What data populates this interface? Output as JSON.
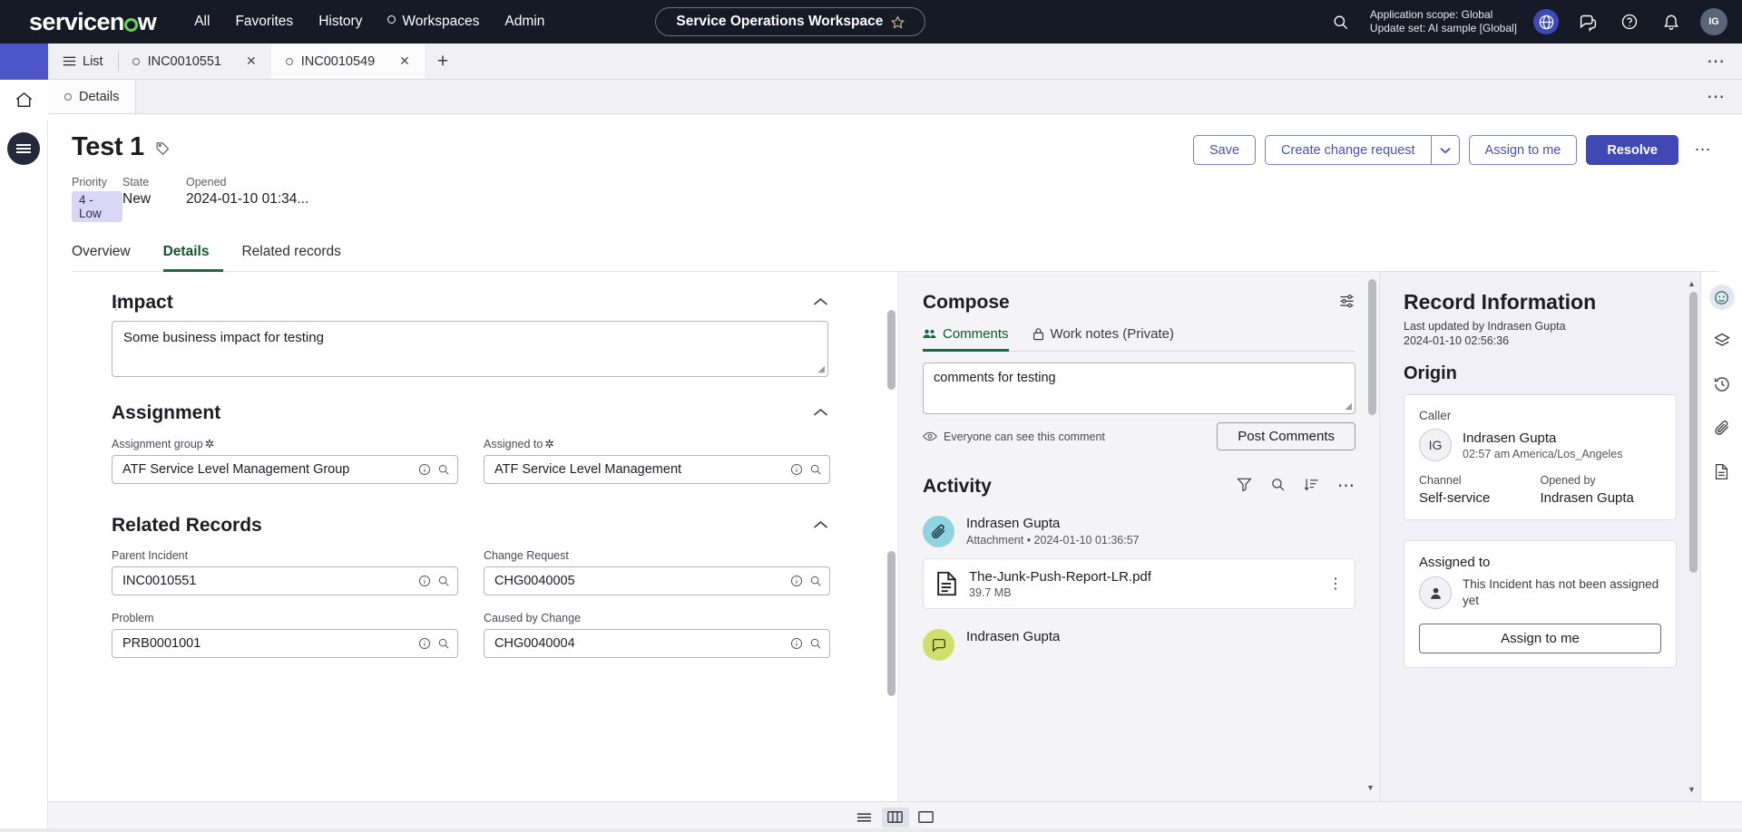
{
  "topnav": {
    "brand": "servicenow",
    "links": [
      {
        "label": "All",
        "icon": ""
      },
      {
        "label": "Favorites",
        "icon": ""
      },
      {
        "label": "History",
        "icon": ""
      },
      {
        "label": "Workspaces",
        "icon": "circle-icon"
      },
      {
        "label": "Admin",
        "icon": ""
      }
    ],
    "workspace_pill": "Service Operations Workspace",
    "star_icon": "star-icon",
    "search_icon": "search-icon",
    "app_scope": "Application scope: Global",
    "update_set": "Update set: AI sample [Global]",
    "globe_icon": "globe-icon",
    "chat_icon": "chat-icon",
    "help_icon": "help-icon",
    "bell_icon": "bell-icon",
    "avatar_initials": "IG"
  },
  "tabstrip": {
    "list_label": "List",
    "list_icon": "list-icon",
    "tabs": [
      {
        "label": "INC0010551",
        "active": false,
        "close_icon": "close-icon"
      },
      {
        "label": "INC0010549",
        "active": true,
        "close_icon": "close-icon"
      }
    ],
    "plus_icon": "plus-icon",
    "overflow_icon": "more-icon"
  },
  "subtabs": {
    "items": [
      {
        "label": "Details",
        "active": true
      }
    ],
    "overflow_icon": "more-icon"
  },
  "record": {
    "title": "Test 1",
    "tag_icon": "tag-icon",
    "meta": [
      {
        "label": "Priority",
        "value": "4 - Low",
        "badge": true
      },
      {
        "label": "State",
        "value": "New",
        "badge": false
      },
      {
        "label": "Opened",
        "value": "2024-01-10 01:34...",
        "badge": false
      }
    ],
    "actions": {
      "save": "Save",
      "create_change_request": "Create change request",
      "caret_icon": "chevron-down-icon",
      "assign_to_me": "Assign to me",
      "resolve": "Resolve",
      "more_icon": "more-icon"
    },
    "page_tabs": [
      {
        "label": "Overview",
        "active": false
      },
      {
        "label": "Details",
        "active": true
      },
      {
        "label": "Related records",
        "active": false
      }
    ]
  },
  "form": {
    "drag_icon": "drag-handle-icon",
    "sections": [
      {
        "title": "Impact",
        "collapse_icon": "chevron-up-icon",
        "textarea_value": "Some business impact for testing"
      },
      {
        "title": "Assignment",
        "collapse_icon": "chevron-up-icon",
        "fields": [
          {
            "label": "Assignment group",
            "required": true,
            "value": "ATF Service Level Management  Group",
            "info_icon": "info-icon",
            "search_icon": "search-icon"
          },
          {
            "label": "Assigned to",
            "required": true,
            "value": "ATF Service Level Management",
            "info_icon": "info-icon",
            "search_icon": "search-icon"
          }
        ]
      },
      {
        "title": "Related Records",
        "collapse_icon": "chevron-up-icon",
        "fields": [
          {
            "label": "Parent Incident",
            "required": false,
            "value": "INC0010551",
            "info_icon": "info-icon",
            "search_icon": "search-icon"
          },
          {
            "label": "Change Request",
            "required": false,
            "value": "CHG0040005",
            "info_icon": "info-icon",
            "search_icon": "search-icon"
          },
          {
            "label": "Problem",
            "required": false,
            "value": "PRB0001001",
            "info_icon": "info-icon",
            "search_icon": "search-icon"
          },
          {
            "label": "Caused by Change",
            "required": false,
            "value": "CHG0040004",
            "info_icon": "info-icon",
            "search_icon": "search-icon"
          }
        ]
      }
    ]
  },
  "compose": {
    "title": "Compose",
    "settings_icon": "sliders-icon",
    "tabs": [
      {
        "label": "Comments",
        "icon": "people-icon",
        "active": true
      },
      {
        "label": "Work notes (Private)",
        "icon": "lock-icon",
        "active": false
      }
    ],
    "comment_value": "comments for testing",
    "comment_placeholder": "",
    "visibility_note": "Everyone can see this comment",
    "visibility_icon": "eye-icon",
    "post_button": "Post Comments"
  },
  "activity": {
    "title": "Activity",
    "filter_icon": "filter-icon",
    "search_icon": "search-icon",
    "sort_icon": "sort-descending-icon",
    "more_icon": "more-icon",
    "entries": [
      {
        "author": "Indrasen Gupta",
        "subtitle": "Attachment • 2024-01-10 01:36:57",
        "avatar_icon": "paperclip-icon",
        "attachment": {
          "file_name": "The-Junk-Push-Report-LR.pdf",
          "file_size": "39.7 MB",
          "file_icon": "document-icon",
          "menu_icon": "kebab-icon"
        }
      },
      {
        "author": "Indrasen Gupta",
        "subtitle": "",
        "avatar_icon": "comment-icon"
      }
    ]
  },
  "record_info": {
    "title": "Record Information",
    "last_updated_by": "Last updated by Indrasen Gupta",
    "last_updated_at": "2024-01-10 02:56:36",
    "origin_title": "Origin",
    "caller": {
      "label": "Caller",
      "initials": "IG",
      "name": "Indrasen Gupta",
      "timezone": "02:57 am America/Los_Angeles"
    },
    "channel": {
      "label": "Channel",
      "value": "Self-service"
    },
    "opened_by": {
      "label": "Opened by",
      "value": "Indrasen Gupta"
    },
    "assigned_to": {
      "label": "Assigned to",
      "avatar_icon": "user-icon",
      "message": "This Incident has not been assigned yet",
      "button": "Assign to me"
    }
  },
  "far_rail": {
    "icons": [
      {
        "name": "agent-assist-icon",
        "active": true
      },
      {
        "name": "layers-icon",
        "active": false
      },
      {
        "name": "history-icon",
        "active": false
      },
      {
        "name": "paperclip-icon",
        "active": false
      },
      {
        "name": "notes-icon",
        "active": false
      }
    ]
  },
  "bottom_bar": {
    "buttons": [
      {
        "name": "layout-list-icon",
        "active": false
      },
      {
        "name": "layout-split-icon",
        "active": true
      },
      {
        "name": "layout-single-icon",
        "active": false
      }
    ]
  },
  "colors": {
    "brand_dark": "#161a26",
    "accent_green": "#62d84e",
    "primary_purple": "#3f48b3",
    "link_purple": "#4a4fb8",
    "tab_green": "#1a6b42",
    "priority_badge_bg": "#d9d7f5"
  }
}
